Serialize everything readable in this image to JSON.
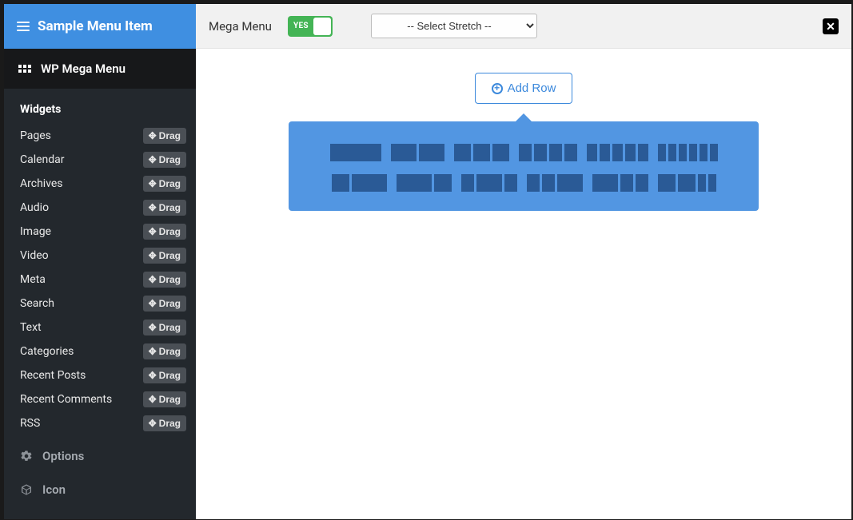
{
  "sidebar": {
    "header_title": "Sample Menu Item",
    "active_tab": "WP Mega Menu",
    "widgets_title": "Widgets",
    "drag_label": "Drag",
    "widgets": [
      {
        "label": "Pages"
      },
      {
        "label": "Calendar"
      },
      {
        "label": "Archives"
      },
      {
        "label": "Audio"
      },
      {
        "label": "Image"
      },
      {
        "label": "Video"
      },
      {
        "label": "Meta"
      },
      {
        "label": "Search"
      },
      {
        "label": "Text"
      },
      {
        "label": "Categories"
      },
      {
        "label": "Recent Posts"
      },
      {
        "label": "Recent Comments"
      },
      {
        "label": "RSS"
      }
    ],
    "options_label": "Options",
    "icon_label": "Icon"
  },
  "topbar": {
    "mega_menu_label": "Mega Menu",
    "toggle_state": "YES",
    "stretch_placeholder": "-- Select Stretch --"
  },
  "canvas": {
    "add_row_label": "Add Row",
    "layout_rows": [
      [
        [
          64
        ],
        [
          32,
          32
        ],
        [
          21,
          21,
          21
        ],
        [
          16,
          16,
          16,
          16
        ],
        [
          13,
          13,
          13,
          13,
          13
        ],
        [
          10,
          10,
          10,
          10,
          10,
          10
        ]
      ],
      [
        [
          22,
          44
        ],
        [
          44,
          22
        ],
        [
          16,
          32,
          16
        ],
        [
          16,
          16,
          32
        ],
        [
          32,
          16,
          16
        ],
        [
          22,
          22,
          10,
          10
        ]
      ]
    ]
  }
}
